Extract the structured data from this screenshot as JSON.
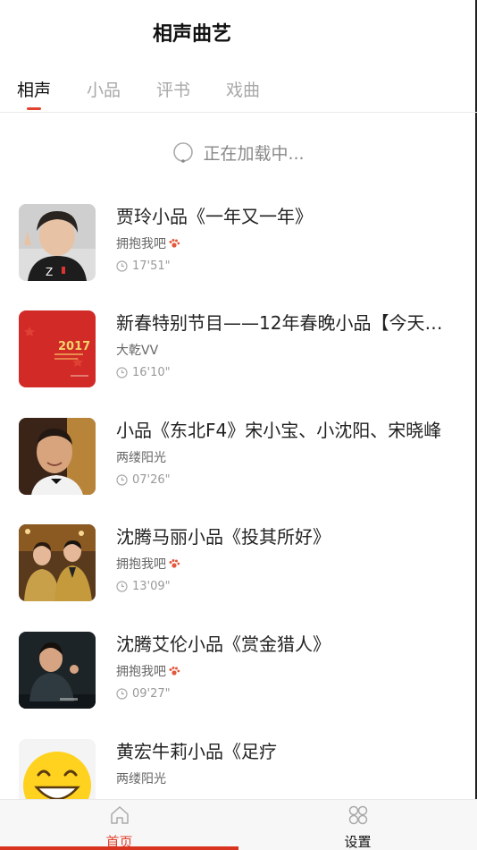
{
  "header": {
    "title": "相声曲艺"
  },
  "tabs": [
    {
      "label": "相声",
      "active": true
    },
    {
      "label": "小品",
      "active": false
    },
    {
      "label": "评书",
      "active": false
    },
    {
      "label": "戏曲",
      "active": false
    }
  ],
  "loading": {
    "text": "正在加载中..."
  },
  "items": [
    {
      "title": "贾玲小品《一年又一年》",
      "author": "拥抱我吧",
      "author_icon": "paw-icon",
      "duration": "17'51\""
    },
    {
      "title": "新春特别节目——12年春晚小品【今天要…",
      "author": "大乾VV",
      "duration": "16'10\"",
      "thumb_text": "2017"
    },
    {
      "title": "小品《东北F4》宋小宝、小沈阳、宋晓峰",
      "author": "两缕阳光",
      "duration": "07'26\""
    },
    {
      "title": "沈腾马丽小品《投其所好》",
      "author": "拥抱我吧",
      "author_icon": "paw-icon",
      "duration": "13'09\""
    },
    {
      "title": "沈腾艾伦小品《赏金猎人》",
      "author": "拥抱我吧",
      "author_icon": "paw-icon",
      "duration": "09'27\""
    },
    {
      "title": "黄宏牛莉小品《足疗",
      "author": "两缕阳光",
      "duration": ""
    }
  ],
  "bottom_nav": [
    {
      "label": "首页",
      "icon": "home-icon",
      "active": true
    },
    {
      "label": "设置",
      "icon": "settings-grid-icon",
      "active": false
    }
  ],
  "colors": {
    "accent": "#e2432f",
    "tab_inactive": "#a8a8a8",
    "nav_bg": "#f7f7f7"
  }
}
